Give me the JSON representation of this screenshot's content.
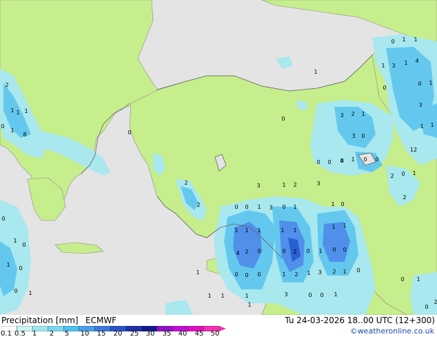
{
  "map": {
    "colors": {
      "sea": "#e4e4e4",
      "land": "#c6ee8c",
      "land_alt": "#b0e070",
      "precip_light": "#a8e8ee",
      "precip_mid": "#64c8ee",
      "precip_heavy": "#5090ea",
      "precip_very_heavy": "#2860d0"
    },
    "value_labels": [
      "2",
      "1",
      "1",
      "1",
      "8",
      "1",
      "0",
      "0",
      "0",
      "1",
      "0",
      "1",
      "1",
      "1",
      "3",
      "1",
      "4",
      "0",
      "0",
      "1",
      "3",
      "1",
      "1",
      "3",
      "2",
      "1",
      "3",
      "0",
      "0",
      "0",
      "0",
      "4",
      "1",
      "0",
      "0",
      "2",
      "0",
      "1",
      "2",
      "12",
      "2",
      "2",
      "3",
      "1",
      "2",
      "3",
      "0",
      "0",
      "1",
      "3",
      "0",
      "1",
      "1",
      "0",
      "1",
      "1",
      "1",
      "1",
      "1",
      "1",
      "1",
      "4",
      "2",
      "0",
      "0",
      "2",
      "0",
      "1",
      "0",
      "0",
      "1",
      "0",
      "0",
      "0",
      "1",
      "2",
      "1",
      "3",
      "2",
      "1",
      "0",
      "1",
      "1",
      "1",
      "3",
      "0",
      "0",
      "1",
      "0",
      "1",
      "0",
      "1",
      "0",
      "0",
      "1",
      "1",
      "0",
      "2",
      "0",
      "1"
    ]
  },
  "footer": {
    "legend_label": "Precipitation [mm]",
    "model": "ECMWF",
    "valid_time": "Tu 24-03-2026 18..00 UTC (12+300)",
    "copyright": "©weatheronline.co.uk",
    "scale_ticks": [
      "0.1",
      "0.5",
      "1",
      "2",
      "5",
      "10",
      "15",
      "20",
      "25",
      "30",
      "35",
      "40",
      "45",
      "50"
    ],
    "scale_colors": [
      "#ffffff",
      "#c8f4f4",
      "#a0e6f0",
      "#78d6f0",
      "#50c0ee",
      "#4a9ee8",
      "#3c78dc",
      "#2a52c8",
      "#1c32a8",
      "#101a88",
      "#9010c8",
      "#c010d0",
      "#e010c0",
      "#f030b0"
    ]
  }
}
